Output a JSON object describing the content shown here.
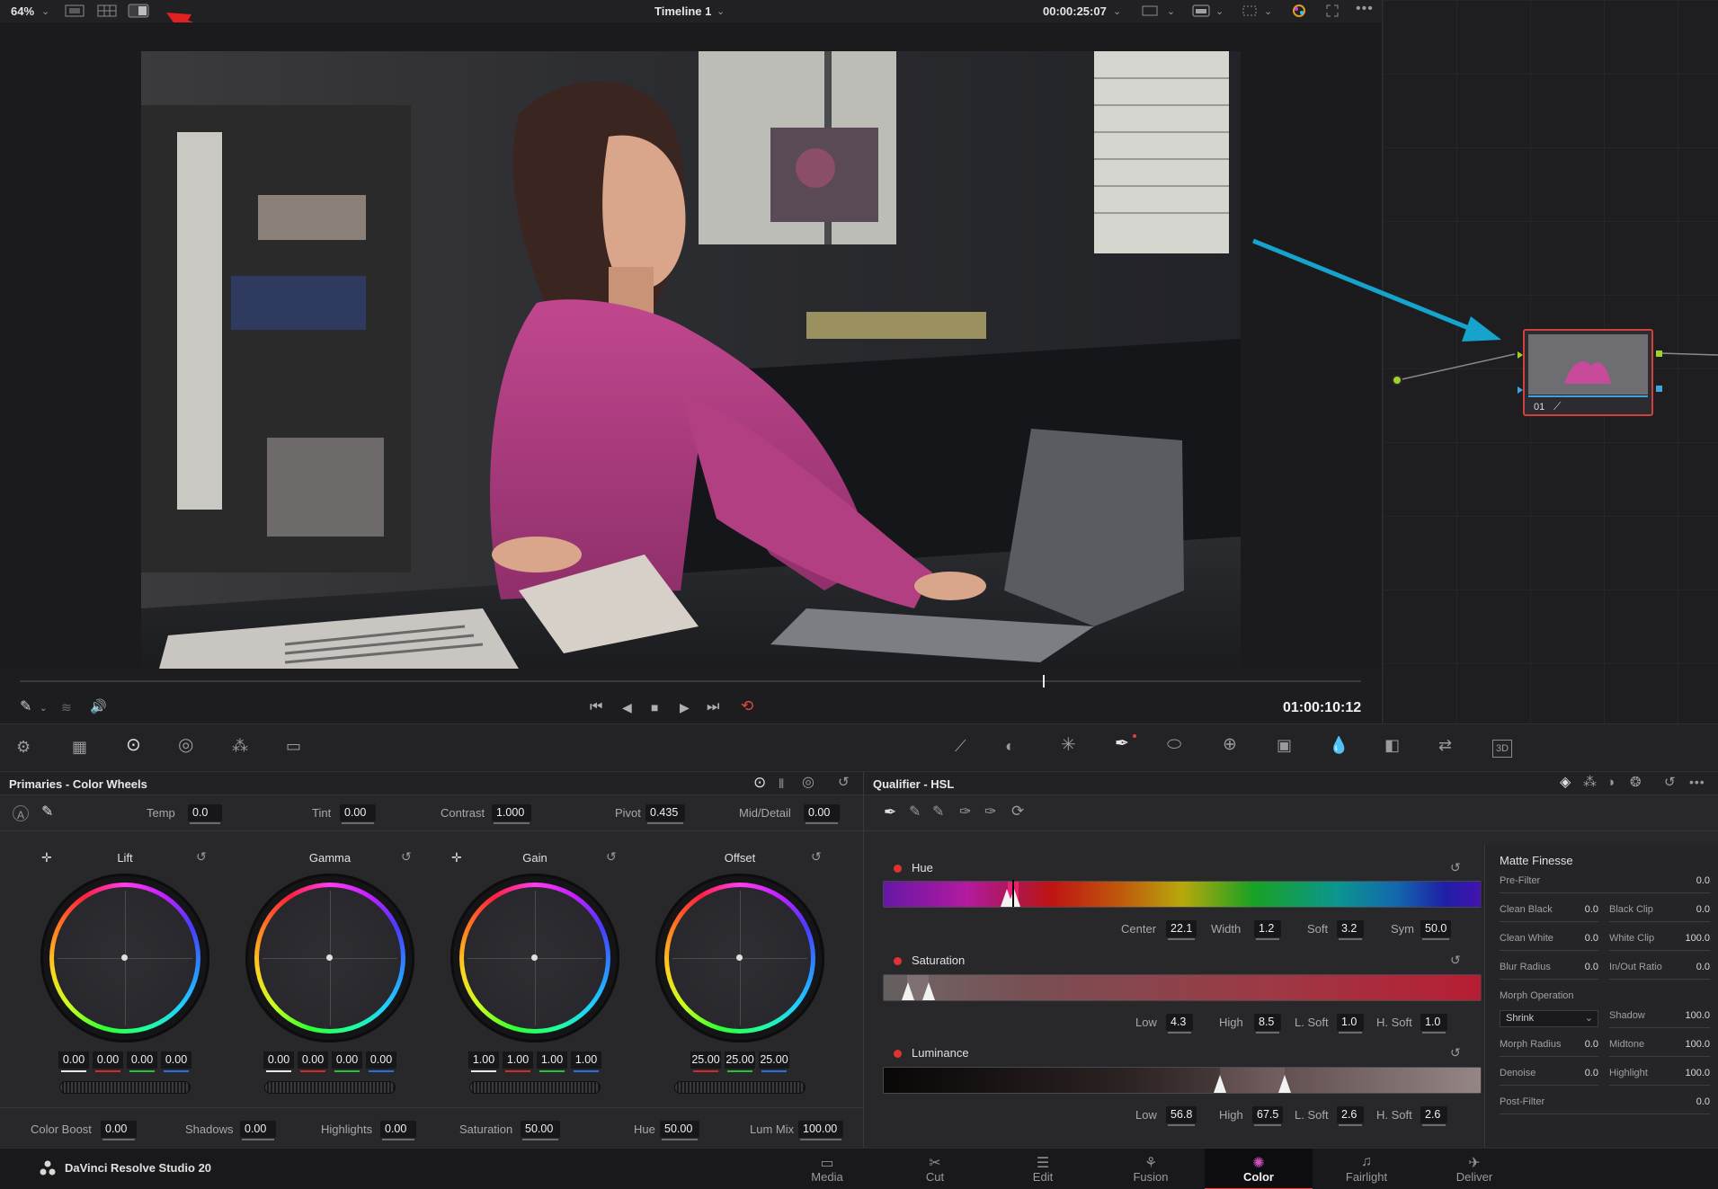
{
  "top": {
    "zoom": "64%",
    "timeline": "Timeline 1",
    "timecode_top": "00:00:25:07"
  },
  "transport": {
    "timecode": "01:00:10:12"
  },
  "node": {
    "label": "01"
  },
  "primaries": {
    "title": "Primaries - Color Wheels",
    "temp_label": "Temp",
    "temp": "0.0",
    "tint_label": "Tint",
    "tint": "0.00",
    "contrast_label": "Contrast",
    "contrast": "1.000",
    "pivot_label": "Pivot",
    "pivot": "0.435",
    "middetail_label": "Mid/Detail",
    "middetail": "0.00",
    "wheels": [
      {
        "name": "Lift",
        "values": [
          "0.00",
          "0.00",
          "0.00",
          "0.00"
        ]
      },
      {
        "name": "Gamma",
        "values": [
          "0.00",
          "0.00",
          "0.00",
          "0.00"
        ]
      },
      {
        "name": "Gain",
        "values": [
          "1.00",
          "1.00",
          "1.00",
          "1.00"
        ]
      },
      {
        "name": "Offset",
        "values": [
          "25.00",
          "25.00",
          "25.00"
        ]
      }
    ],
    "colorboost_label": "Color Boost",
    "colorboost": "0.00",
    "shadows_label": "Shadows",
    "shadows": "0.00",
    "highlights_label": "Highlights",
    "highlights": "0.00",
    "saturation_label": "Saturation",
    "saturation": "50.00",
    "hue_label": "Hue",
    "hue": "50.00",
    "lummix_label": "Lum Mix",
    "lummix": "100.00"
  },
  "qualifier": {
    "title": "Qualifier - HSL",
    "hue": {
      "label": "Hue",
      "center_label": "Center",
      "center": "22.1",
      "width_label": "Width",
      "width": "1.2",
      "soft_label": "Soft",
      "soft": "3.2",
      "sym_label": "Sym",
      "sym": "50.0"
    },
    "saturation": {
      "label": "Saturation",
      "low_label": "Low",
      "low": "4.3",
      "high_label": "High",
      "high": "8.5",
      "lsoft_label": "L. Soft",
      "lsoft": "1.0",
      "hsoft_label": "H. Soft",
      "hsoft": "1.0"
    },
    "luminance": {
      "label": "Luminance",
      "low_label": "Low",
      "low": "56.8",
      "high_label": "High",
      "high": "67.5",
      "lsoft_label": "L. Soft",
      "lsoft": "2.6",
      "hsoft_label": "H. Soft",
      "hsoft": "2.6"
    }
  },
  "matte": {
    "title": "Matte Finesse",
    "prefilter_label": "Pre-Filter",
    "prefilter": "0.0",
    "cleanblack_label": "Clean Black",
    "cleanblack": "0.0",
    "blackclip_label": "Black Clip",
    "blackclip": "0.0",
    "cleanwhite_label": "Clean White",
    "cleanwhite": "0.0",
    "whiteclip_label": "White Clip",
    "whiteclip": "100.0",
    "blurradius_label": "Blur Radius",
    "blurradius": "0.0",
    "inoutratio_label": "In/Out Ratio",
    "inoutratio": "0.0",
    "morphop_label": "Morph Operation",
    "morphop": "Shrink",
    "shadow_label": "Shadow",
    "shadow": "100.0",
    "morphradius_label": "Morph Radius",
    "morphradius": "0.0",
    "midtone_label": "Midtone",
    "midtone": "100.0",
    "denoise_label": "Denoise",
    "denoise": "0.0",
    "highlight_label": "Highlight",
    "highlight": "100.0",
    "postfilter_label": "Post-Filter",
    "postfilter": "0.0"
  },
  "footer": {
    "app": "DaVinci Resolve Studio 20",
    "pages": [
      "Media",
      "Cut",
      "Edit",
      "Fusion",
      "Color",
      "Fairlight",
      "Deliver"
    ],
    "active_page": "Color"
  }
}
